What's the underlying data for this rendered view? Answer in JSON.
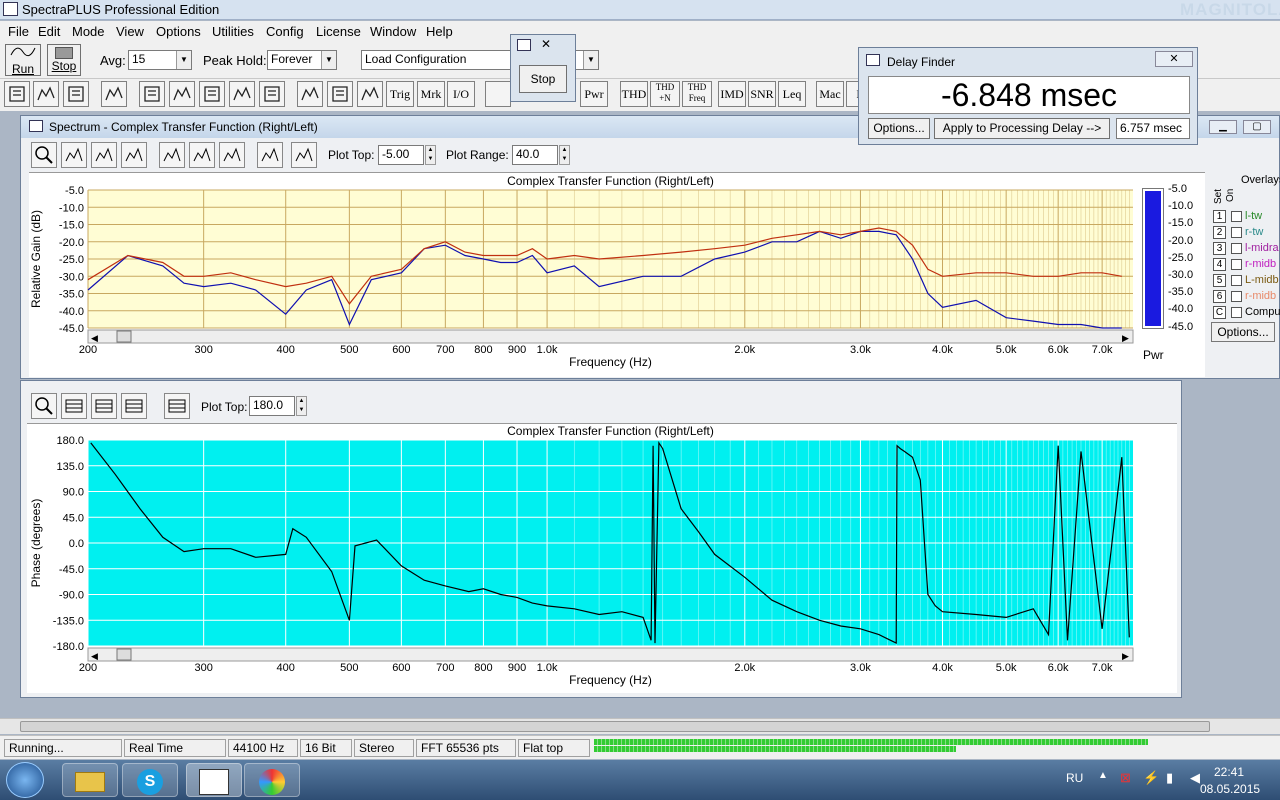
{
  "app": {
    "title": "SpectraPLUS Professional Edition",
    "watermark": "MAGNITOLA"
  },
  "menu": [
    "File",
    "Edit",
    "Mode",
    "View",
    "Options",
    "Utilities",
    "Config",
    "License",
    "Window",
    "Help"
  ],
  "toolbar": {
    "run": "Run",
    "stop": "Stop",
    "avg_label": "Avg:",
    "avg_value": "15",
    "peak_label": "Peak Hold:",
    "peak_value": "Forever",
    "config_value": "Load Configuration",
    "buttons": [
      "Trig",
      "Mrk",
      "I/O",
      "Pwr",
      "THD",
      "THD +N",
      "THD Freq",
      "IMD",
      "SNR",
      "Leq",
      "Mac",
      "L"
    ]
  },
  "stop_popup": {
    "label": "Stop"
  },
  "delay": {
    "title": "Delay Finder",
    "value": "-6.848 msec",
    "options": "Options...",
    "apply": "Apply to Processing Delay -->",
    "result": "6.757 msec"
  },
  "spectrum": {
    "title": "Spectrum - Complex Transfer Function (Right/Left)",
    "plot_top_label": "Plot Top:",
    "plot_top": "-5.00",
    "range_label": "Plot Range:",
    "range": "40.0",
    "chart_title": "Complex Transfer Function (Right/Left)",
    "ylabel": "Relative Gain (dB)",
    "xlabel": "Frequency (Hz)",
    "yticks": [
      "-5.0",
      "-10.0",
      "-15.0",
      "-20.0",
      "-25.0",
      "-30.0",
      "-35.0",
      "-40.0",
      "-45.0"
    ],
    "xticks": [
      "200",
      "300",
      "400",
      "500",
      "600",
      "700",
      "800",
      "900",
      "1.0k",
      "2.0k",
      "3.0k",
      "4.0k",
      "5.0k",
      "6.0k",
      "7.0k"
    ],
    "meter_label": "Pwr",
    "overlays": {
      "title": "Overlays",
      "set": "Set",
      "on": "On",
      "items": [
        {
          "n": "1",
          "name": "l-tw",
          "color": "#2a8a2a"
        },
        {
          "n": "2",
          "name": "r-tw",
          "color": "#2a8a8a"
        },
        {
          "n": "3",
          "name": "l-midra",
          "color": "#a020a0"
        },
        {
          "n": "4",
          "name": "r-midb",
          "color": "#c020c0"
        },
        {
          "n": "5",
          "name": "L-midb",
          "color": "#7a5a10"
        },
        {
          "n": "6",
          "name": "r-midb",
          "color": "#e88a6a"
        },
        {
          "n": "C",
          "name": "Compu",
          "color": "#000000"
        }
      ],
      "options": "Options..."
    }
  },
  "phase": {
    "plot_top_label": "Plot Top:",
    "plot_top": "180.0",
    "chart_title": "Complex Transfer Function (Right/Left)",
    "ylabel": "Phase (degrees)",
    "xlabel": "Frequency (Hz)",
    "yticks": [
      "180.0",
      "135.0",
      "90.0",
      "45.0",
      "0.0",
      "-45.0",
      "-90.0",
      "-135.0",
      "-180.0"
    ]
  },
  "status": [
    "Running...",
    "Real Time",
    "44100 Hz",
    "16 Bit",
    "Stereo",
    "FFT 65536 pts",
    "Flat top"
  ],
  "taskbar": {
    "lang": "RU",
    "time": "22:41",
    "date": "08.05.2015"
  },
  "chart_data": [
    {
      "type": "line",
      "title": "Complex Transfer Function (Right/Left)",
      "xlabel": "Frequency (Hz)",
      "ylabel": "Relative Gain (dB)",
      "xscale": "log",
      "xlim": [
        200,
        7800
      ],
      "ylim": [
        -45,
        -5
      ],
      "series": [
        {
          "color": "#1010b0",
          "x": [
            200,
            230,
            260,
            280,
            300,
            330,
            360,
            400,
            430,
            470,
            500,
            540,
            600,
            650,
            700,
            750,
            800,
            850,
            900,
            950,
            1000,
            1100,
            1200,
            1400,
            1600,
            1800,
            2000,
            2200,
            2400,
            2600,
            2800,
            3000,
            3200,
            3400,
            3600,
            3800,
            4000,
            4500,
            5000,
            5500,
            6000,
            6500,
            7000,
            7500
          ],
          "y": [
            -34,
            -24,
            -27,
            -32,
            -33,
            -32,
            -34,
            -41,
            -34,
            -31,
            -44,
            -31,
            -29,
            -22,
            -21,
            -24,
            -25,
            -26,
            -26,
            -24,
            -29,
            -27,
            -33,
            -30,
            -30,
            -25,
            -23,
            -20,
            -20,
            -17,
            -19,
            -17,
            -17,
            -18,
            -25,
            -35,
            -39,
            -37,
            -42,
            -43,
            -44,
            -44,
            -45,
            -45
          ]
        },
        {
          "color": "#c03010",
          "x": [
            200,
            230,
            260,
            280,
            300,
            330,
            360,
            400,
            430,
            470,
            500,
            540,
            600,
            650,
            700,
            750,
            800,
            850,
            900,
            950,
            1000,
            1100,
            1200,
            1400,
            1600,
            1800,
            2000,
            2200,
            2400,
            2600,
            2800,
            3000,
            3200,
            3400,
            3600,
            3800,
            4000,
            4500,
            5000,
            5500,
            6000,
            6500,
            7000,
            7500
          ],
          "y": [
            -31,
            -24,
            -26,
            -30,
            -30,
            -29,
            -31,
            -33,
            -32,
            -30,
            -38,
            -30,
            -28,
            -22,
            -20,
            -23,
            -24,
            -24,
            -24,
            -22,
            -25,
            -24,
            -25,
            -24,
            -23,
            -22,
            -21,
            -19,
            -18,
            -17,
            -18,
            -17,
            -16,
            -17,
            -21,
            -28,
            -30,
            -29,
            -29,
            -30,
            -30,
            -29,
            -29,
            -30
          ]
        }
      ]
    },
    {
      "type": "line",
      "title": "Complex Transfer Function (Right/Left)",
      "xlabel": "Frequency (Hz)",
      "ylabel": "Phase (degrees)",
      "xscale": "log",
      "xlim": [
        200,
        7800
      ],
      "ylim": [
        -180,
        180
      ],
      "series": [
        {
          "color": "#000000",
          "x": [
            202,
            220,
            240,
            260,
            280,
            300,
            330,
            360,
            400,
            410,
            430,
            470,
            500,
            510,
            550,
            600,
            650,
            700,
            760,
            800,
            850,
            900,
            950,
            1000,
            1100,
            1200,
            1300,
            1400,
            1440,
            1450,
            1460,
            1480,
            1500,
            1600,
            1700,
            1800,
            2000,
            2200,
            2400,
            2600,
            2800,
            3000,
            3200,
            3400,
            3410,
            3450,
            3500,
            3600,
            3700,
            3800,
            3900,
            4000,
            4500,
            5000,
            5500,
            5800,
            6000,
            6200,
            6500,
            7000,
            7500,
            7700
          ],
          "y": [
            175,
            120,
            60,
            10,
            -15,
            -10,
            -10,
            -25,
            -20,
            25,
            10,
            -50,
            -135,
            -5,
            5,
            -40,
            -65,
            -75,
            -85,
            -80,
            -90,
            -95,
            -105,
            -110,
            -115,
            -125,
            -120,
            -130,
            -170,
            170,
            -175,
            175,
            165,
            60,
            20,
            -20,
            -60,
            -100,
            -120,
            -135,
            -145,
            -150,
            -160,
            -175,
            170,
            165,
            160,
            150,
            110,
            -90,
            -110,
            -120,
            -125,
            -130,
            -115,
            -160,
            170,
            -170,
            160,
            -150,
            150,
            -165
          ]
        }
      ]
    }
  ]
}
